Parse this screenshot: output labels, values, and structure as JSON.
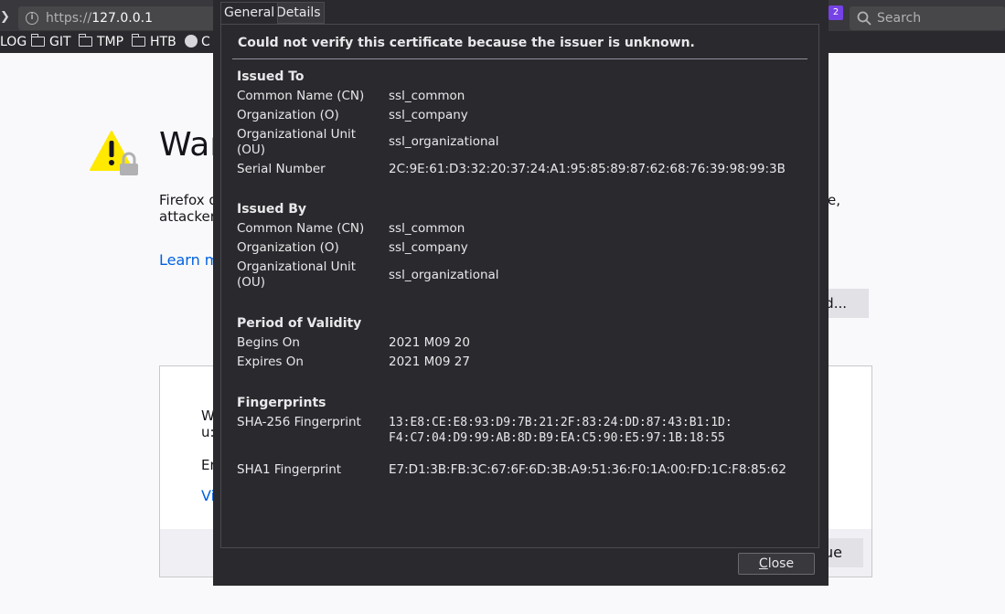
{
  "browser": {
    "url_scheme": "https://",
    "url_host": "127.0.0.1",
    "badge_count": "2",
    "search_placeholder": "Search",
    "bookmarks": [
      "LOG",
      "GIT",
      "TMP",
      "HTB",
      "C"
    ]
  },
  "page": {
    "title_fragment": "War",
    "text_line1": "Firefox d",
    "text_line1_end": "e,",
    "text_line2": "attacker",
    "learn_more": "Learn m",
    "advanced_label": "d...",
    "panel_line1a": "W",
    "panel_line1b": "u:",
    "panel_line2": "Er",
    "panel_link": "Vi",
    "accept_label": "ue"
  },
  "dialog": {
    "tabs": [
      "General",
      "Details"
    ],
    "verify_message": "Could not verify this certificate because the issuer is unknown.",
    "issued_to": {
      "heading": "Issued To",
      "rows": [
        {
          "label": "Common Name (CN)",
          "value": "ssl_common"
        },
        {
          "label": "Organization (O)",
          "value": "ssl_company"
        },
        {
          "label": "Organizational Unit (OU)",
          "value": "ssl_organizational"
        },
        {
          "label": "Serial Number",
          "value": "2C:9E:61:D3:32:20:37:24:A1:95:85:89:87:62:68:76:39:98:99:3B"
        }
      ]
    },
    "issued_by": {
      "heading": "Issued By",
      "rows": [
        {
          "label": "Common Name (CN)",
          "value": "ssl_common"
        },
        {
          "label": "Organization (O)",
          "value": "ssl_company"
        },
        {
          "label": "Organizational Unit (OU)",
          "value": "ssl_organizational"
        }
      ]
    },
    "validity": {
      "heading": "Period of Validity",
      "rows": [
        {
          "label": "Begins On",
          "value": "2021 M09 20"
        },
        {
          "label": "Expires On",
          "value": "2021 M09 27"
        }
      ]
    },
    "fingerprints": {
      "heading": "Fingerprints",
      "rows": [
        {
          "label": "SHA-256 Fingerprint",
          "value": "13:E8:CE:E8:93:D9:7B:21:2F:83:24:DD:87:43:B1:1D:\nF4:C7:04:D9:99:AB:8D:B9:EA:C5:90:E5:97:1B:18:55"
        },
        {
          "label": "SHA1 Fingerprint",
          "value": "E7:D1:3B:FB:3C:67:6F:6D:3B:A9:51:36:F0:1A:00:FD:1C:F8:85:62"
        }
      ]
    },
    "close_label_ul": "C",
    "close_label_rest": "lose"
  },
  "colors": {
    "dialog_bg": "#2a2a2e",
    "chrome_bg": "#38383d",
    "warning_yellow": "#ffe900",
    "link_blue": "#0060df"
  }
}
